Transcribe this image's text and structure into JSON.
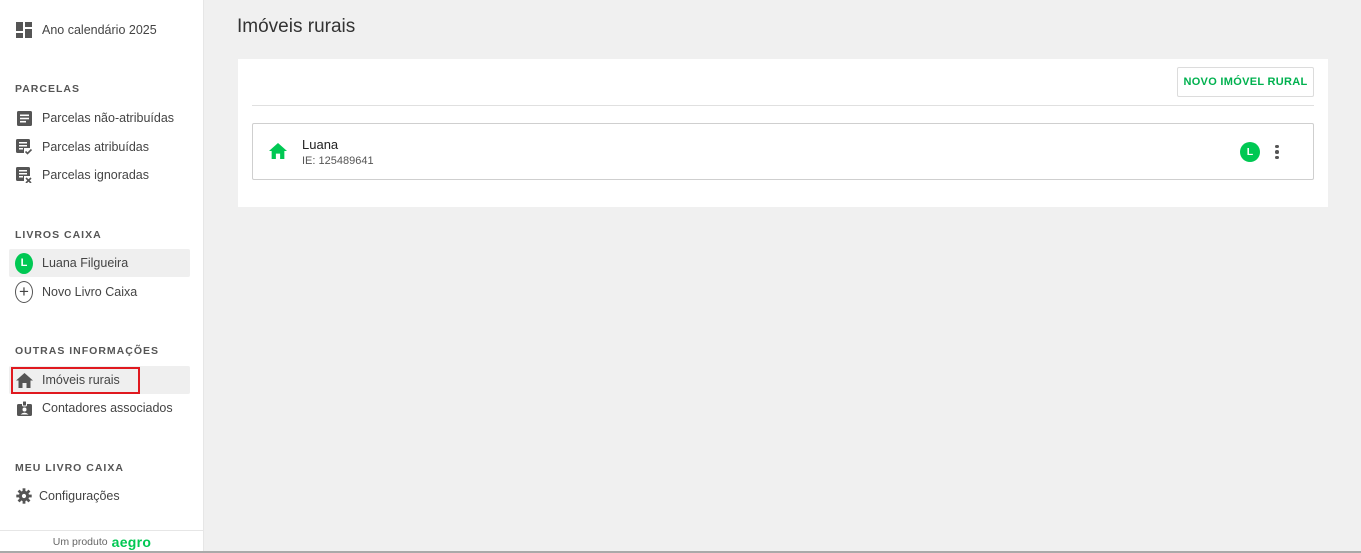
{
  "sidebar": {
    "year": {
      "label": "Ano calendário  2025",
      "icon": "dashboard-icon"
    },
    "parcelas": {
      "title": "PARCELAS",
      "items": [
        {
          "label": "Parcelas não-atribuídas",
          "icon": "document-list-icon"
        },
        {
          "label": "Parcelas atribuídas",
          "icon": "document-check-icon"
        },
        {
          "label": "Parcelas ignoradas",
          "icon": "document-x-icon"
        }
      ]
    },
    "livros": {
      "title": "LIVROS CAIXA",
      "items": [
        {
          "label": "Luana Filgueira",
          "avatar": "L"
        },
        {
          "label": "Novo Livro Caixa",
          "icon": "plus-circle-icon"
        }
      ]
    },
    "outras": {
      "title": "OUTRAS INFORMAÇÕES",
      "items": [
        {
          "label": "Imóveis rurais",
          "icon": "home-icon"
        },
        {
          "label": "Contadores associados",
          "icon": "badge-icon"
        }
      ]
    },
    "meu": {
      "title": "MEU LIVRO CAIXA",
      "items": [
        {
          "label": "Configurações",
          "icon": "gear-icon"
        }
      ]
    },
    "footer": {
      "text": "Um produto",
      "brand": "aegro"
    }
  },
  "main": {
    "title": "Imóveis rurais",
    "new_button": "NOVO IMÓVEL RURAL",
    "properties": [
      {
        "name": "Luana",
        "ie": "IE: 125489641",
        "avatar": "L"
      }
    ]
  },
  "colors": {
    "accent": "#00c853",
    "highlight": "#e0191f"
  }
}
